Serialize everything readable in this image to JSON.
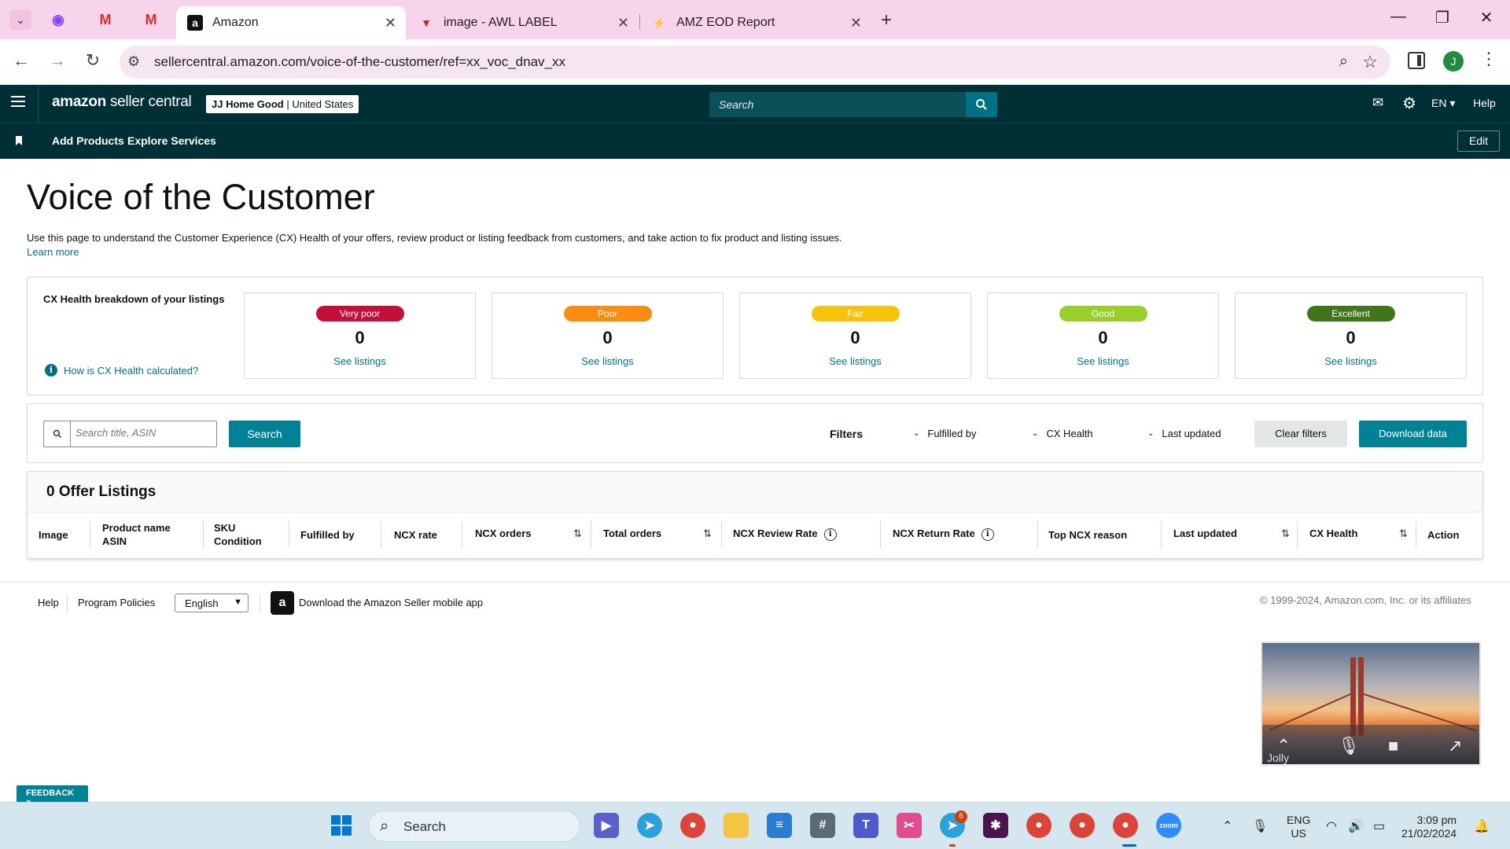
{
  "browser": {
    "tabs": [
      {
        "title": "Amazon",
        "active": true
      },
      {
        "title": "image - AWL LABEL",
        "active": false
      },
      {
        "title": "AMZ EOD Report",
        "active": false
      }
    ],
    "url": "sellercentral.amazon.com/voice-of-the-customer/ref=xx_voc_dnav_xx",
    "profile_initial": "J"
  },
  "header": {
    "logo_main": "amazon",
    "logo_sub": "seller central",
    "store_name": "JJ Home Good",
    "store_region": "United States",
    "search_placeholder": "Search",
    "language": "EN",
    "help": "Help"
  },
  "subnav": {
    "items": [
      "Add Products",
      "Explore Services"
    ],
    "edit": "Edit"
  },
  "page": {
    "title": "Voice of the Customer",
    "description": "Use this page to understand the Customer Experience (CX) Health of your offers, review product or listing feedback from customers, and take action to fix product and listing issues.",
    "learn_more": "Learn more"
  },
  "cx_health": {
    "title": "CX Health breakdown of your listings",
    "info_link": "How is CX Health calculated?",
    "cards": [
      {
        "label": "Very poor",
        "count": "0",
        "link": "See listings",
        "color": "#c40f3b"
      },
      {
        "label": "Poor",
        "count": "0",
        "link": "See listings",
        "color": "#fa8c12"
      },
      {
        "label": "Fair",
        "count": "0",
        "link": "See listings",
        "color": "#f7c20c"
      },
      {
        "label": "Good",
        "count": "0",
        "link": "See listings",
        "color": "#99cf2b"
      },
      {
        "label": "Excellent",
        "count": "0",
        "link": "See listings",
        "color": "#40761a"
      }
    ]
  },
  "filters": {
    "search_placeholder": "Search title, ASIN",
    "search_button": "Search",
    "label": "Filters",
    "dropdowns": [
      "Fulfilled by",
      "CX Health",
      "Last updated"
    ],
    "clear": "Clear filters",
    "download": "Download data"
  },
  "listings": {
    "heading": "0 Offer Listings",
    "columns": {
      "image": "Image",
      "product_name": "Product name",
      "asin": "ASIN",
      "sku": "SKU",
      "condition": "Condition",
      "fulfilled_by": "Fulfilled by",
      "ncx_rate": "NCX rate",
      "ncx_orders": "NCX orders",
      "total_orders": "Total orders",
      "ncx_review_rate": "NCX Review Rate",
      "ncx_return_rate": "NCX Return Rate",
      "top_ncx_reason": "Top NCX reason",
      "last_updated": "Last updated",
      "cx_health": "CX Health",
      "action": "Action"
    }
  },
  "footer": {
    "help": "Help",
    "program_policies": "Program Policies",
    "language": "English",
    "app_link": "Download the Amazon Seller mobile app",
    "copyright": "© 1999-2024, Amazon.com, Inc. or its affiliates"
  },
  "video": {
    "participant": "Jolly"
  },
  "feedback": {
    "label": "FEEDBACK ×"
  },
  "taskbar": {
    "search": "Search",
    "telegram_badge": "6",
    "lang_line1": "ENG",
    "lang_line2": "US",
    "time": "3:09 pm",
    "date": "21/02/2024"
  }
}
